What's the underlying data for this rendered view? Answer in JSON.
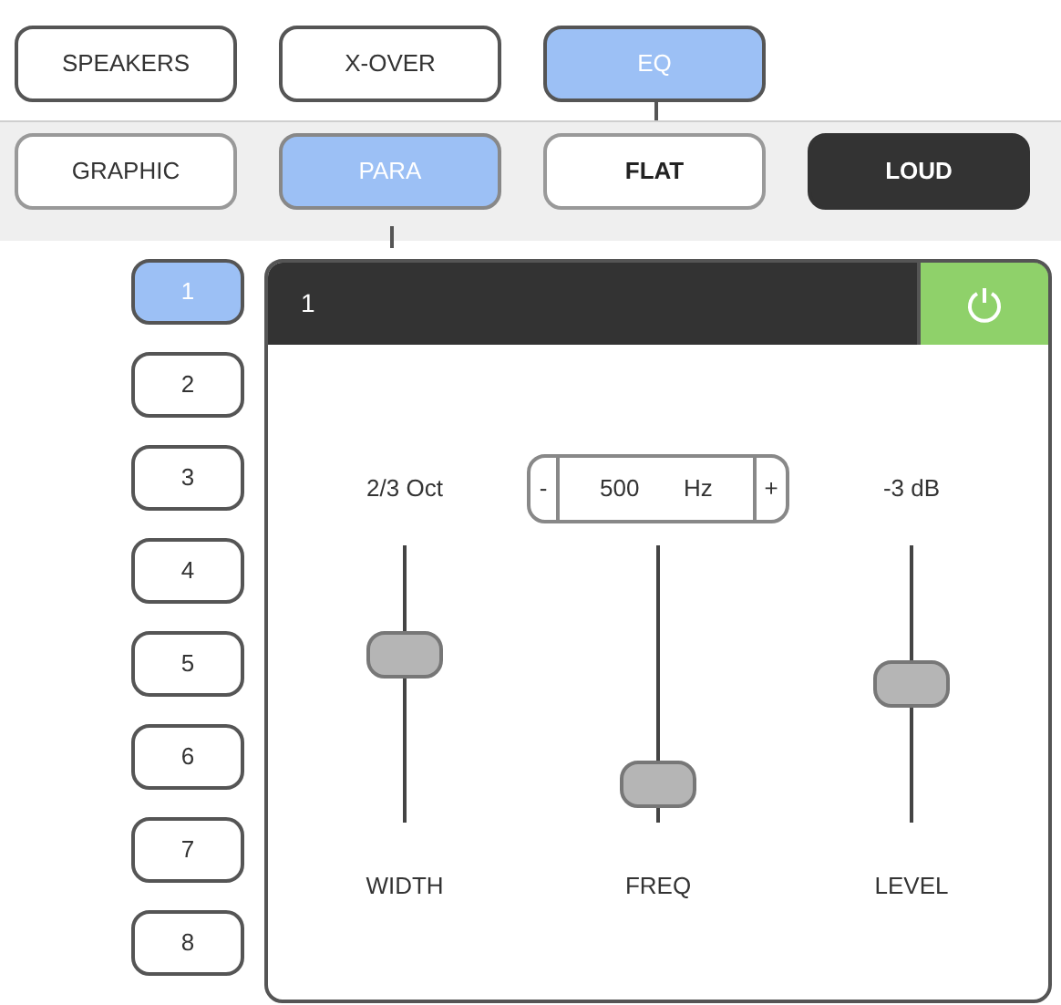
{
  "tabs": [
    {
      "label": "SPEAKERS",
      "selected": false
    },
    {
      "label": "X-OVER",
      "selected": false
    },
    {
      "label": "EQ",
      "selected": true
    }
  ],
  "modes": [
    {
      "label": "GRAPHIC",
      "selected": false
    },
    {
      "label": "PARA",
      "selected": true
    }
  ],
  "toggles": [
    {
      "label": "FLAT",
      "on": false
    },
    {
      "label": "LOUD",
      "on": true
    }
  ],
  "bands": [
    {
      "label": "1",
      "selected": true
    },
    {
      "label": "2",
      "selected": false
    },
    {
      "label": "3",
      "selected": false
    },
    {
      "label": "4",
      "selected": false
    },
    {
      "label": "5",
      "selected": false
    },
    {
      "label": "6",
      "selected": false
    },
    {
      "label": "7",
      "selected": false
    },
    {
      "label": "8",
      "selected": false
    }
  ],
  "panel": {
    "title": "1",
    "power_on": true
  },
  "sliders": [
    {
      "kind": "reading",
      "reading": "2/3 Oct",
      "level": 0.63,
      "label": "WIDTH"
    },
    {
      "kind": "stepper",
      "minus": "-",
      "value": "500",
      "unit": "Hz",
      "plus": "+",
      "level": 0.06,
      "label": "FREQ"
    },
    {
      "kind": "reading",
      "reading": "-3 dB",
      "level": 0.5,
      "label": "LEVEL"
    }
  ]
}
